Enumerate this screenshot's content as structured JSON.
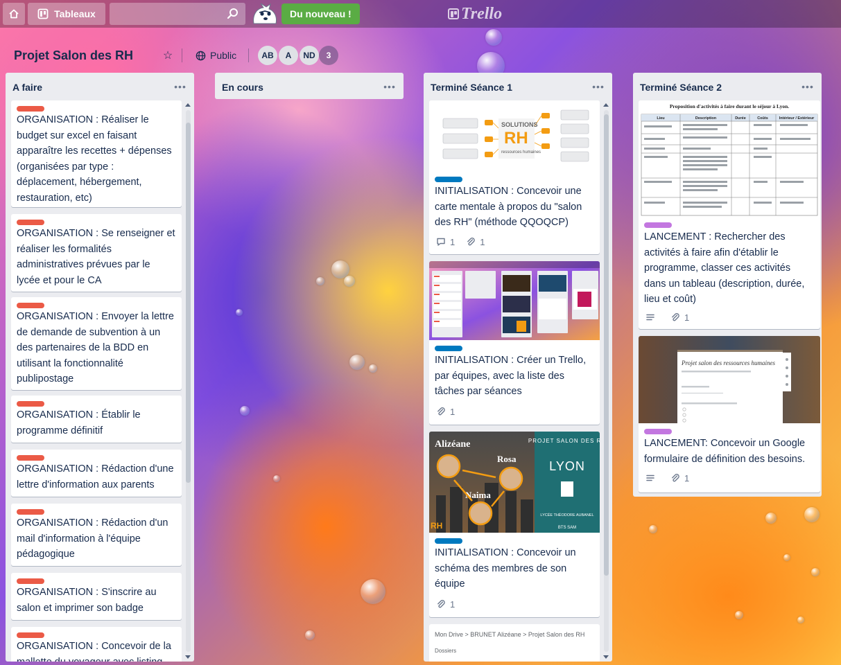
{
  "topbar": {
    "home_label": "",
    "boards_label": "Tableaux",
    "search": {
      "value": "",
      "placeholder": ""
    },
    "news_label": "Du nouveau !",
    "logo_text": "Trello"
  },
  "board": {
    "title": "Projet Salon des RH",
    "visibility": "Public",
    "members": [
      "AB",
      "A",
      "ND"
    ],
    "more_members": "3"
  },
  "colors": {
    "red_label": "#eb5a46",
    "blue_label": "#0079bf",
    "purple_label": "#c377e0",
    "green_badge": "#5aac44"
  },
  "lists": [
    {
      "title": "A faire",
      "cards": [
        {
          "label": "red",
          "title": "ORGANISATION : Réaliser le budget sur excel en faisant apparaître les recettes + dépenses (organisées par type : déplacement, hébergement, restauration, etc)"
        },
        {
          "label": "red",
          "title": "ORGANISATION : Se renseigner et réaliser les formalités administratives prévues par le lycée et pour le CA"
        },
        {
          "label": "red",
          "title": "ORGANISATION : Envoyer la lettre de demande de subvention à un des partenaires de la BDD en utilisant la fonctionnalité publipostage"
        },
        {
          "label": "red",
          "title": "ORGANISATION : Établir le programme définitif"
        },
        {
          "label": "red",
          "title": "ORGANISATION : Rédaction d'une lettre d'information aux parents"
        },
        {
          "label": "red",
          "title": "ORGANISATION : Rédaction d'un mail d'information à l'équipe pédagogique"
        },
        {
          "label": "red",
          "title": "ORGANISATION : S'inscrire au salon et imprimer son badge"
        },
        {
          "label": "red",
          "title": "ORGANISATION : Concevoir de la mallette du voyageur avec listing"
        }
      ]
    },
    {
      "title": "En cours",
      "cards": []
    },
    {
      "title": "Terminé Séance 1",
      "cards": [
        {
          "label": "blue",
          "cover": "mindmap",
          "cover_text": "SOLUTIONS RH",
          "cover_subtext": "ressources humaines",
          "title": "INITIALISATION : Concevoir une carte mentale à propos du \"salon des RH\" (méthode QQOQCP)",
          "comments": "1",
          "attachments": "1"
        },
        {
          "label": "blue",
          "cover": "trello",
          "title": "INITIALISATION : Créer un Trello, par équipes, avec la liste des tâches par séances",
          "attachments": "1"
        },
        {
          "label": "blue",
          "cover": "team",
          "cover_names": [
            "Alizéane",
            "Rosa",
            "Naima"
          ],
          "cover_panel": [
            "PROJET SALON DES RH",
            "LYON",
            "LYCÉE THÉODORE AUBANEL",
            "BTS SAM"
          ],
          "title": "INITIALISATION : Concevoir un schéma des membres de son équipe",
          "attachments": "1"
        },
        {
          "cover": "drive",
          "cover_breadcrumb": "Mon Drive  >  BRUNET Alizéane  >  Projet Salon des RH",
          "cover_section": "Dossiers"
        }
      ]
    },
    {
      "title": "Terminé Séance 2",
      "cards": [
        {
          "label": "purple",
          "cover": "table",
          "cover_heading": "Proposition d'activités à faire durant le séjour à Lyon.",
          "cover_columns": [
            "Lieu",
            "Description",
            "Durée",
            "Coûts",
            "Intérieur / Extérieur"
          ],
          "title": "LANCEMENT : Rechercher des activités à faire afin d'établir le programme, classer ces activités dans un tableau (description, durée, lieu et coût)",
          "attachments": "1",
          "has_description": true
        },
        {
          "label": "purple",
          "cover": "form",
          "cover_heading": "Projet salon des ressources humaines",
          "title": "LANCEMENT: Concevoir un Google formulaire de définition des besoins.",
          "attachments": "1",
          "has_description": true
        }
      ]
    }
  ]
}
